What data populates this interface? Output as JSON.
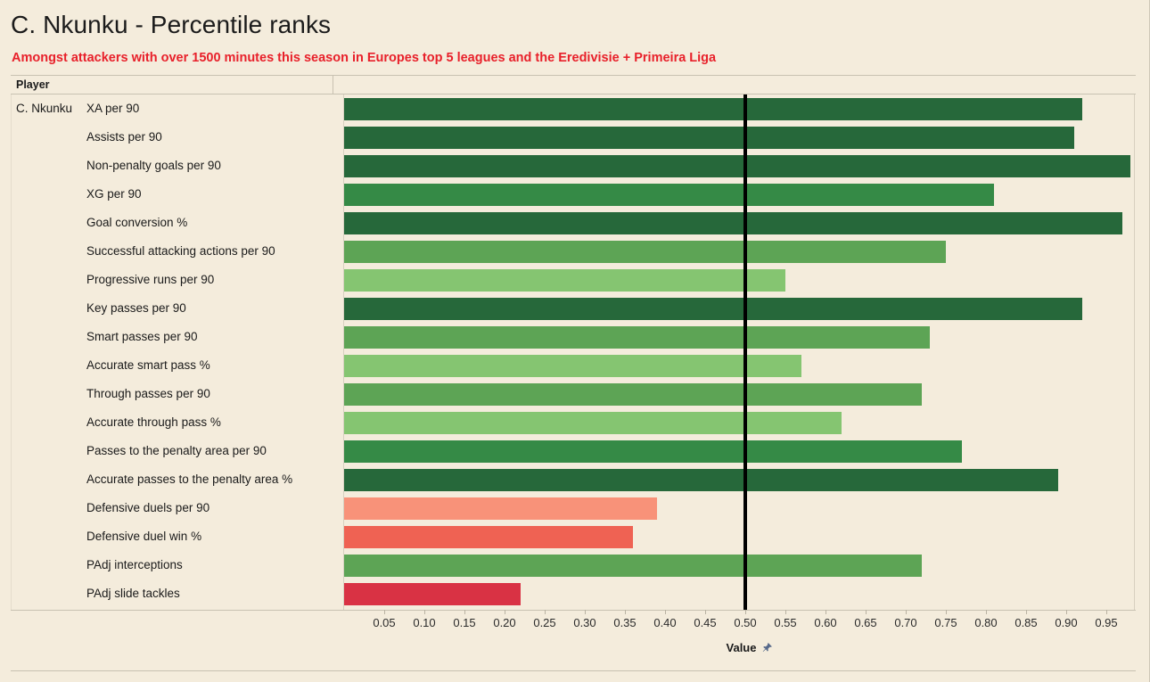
{
  "header": {
    "title": "C. Nkunku - Percentile ranks",
    "subtitle": "Amongst attackers with over 1500 minutes this season in Europes top 5 leagues and the Eredivisie + Primeira Liga",
    "subtitle_color": "#e8202a",
    "column_header": "Player"
  },
  "table": {
    "player_name": "C. Nkunku"
  },
  "axis": {
    "title": "Value",
    "sort_icon": "pin-icon",
    "ticks": [
      "0.05",
      "0.10",
      "0.15",
      "0.20",
      "0.25",
      "0.30",
      "0.35",
      "0.40",
      "0.45",
      "0.50",
      "0.55",
      "0.60",
      "0.65",
      "0.70",
      "0.75",
      "0.80",
      "0.85",
      "0.90",
      "0.95"
    ],
    "reference_value": 0.5
  },
  "palette": {
    "background": "#f4ecdc",
    "dark_green": "#26683a",
    "mid_dark_green": "#358a46",
    "mid_green": "#5da455",
    "light_green": "#85c571",
    "light_red": "#f89279",
    "mid_red": "#ef6253",
    "dark_red": "#d93244",
    "reference_line": "#000000"
  },
  "chart_data": {
    "type": "bar",
    "title": "C. Nkunku - Percentile ranks",
    "subtitle": "Amongst attackers with over 1500 minutes this season in Europes top 5 leagues and the Eredivisie + Primeira Liga",
    "xlabel": "Value",
    "ylabel": "",
    "orientation": "horizontal",
    "xlim": [
      0,
      1.0
    ],
    "xticks": [
      0.05,
      0.1,
      0.15,
      0.2,
      0.25,
      0.3,
      0.35,
      0.4,
      0.45,
      0.5,
      0.55,
      0.6,
      0.65,
      0.7,
      0.75,
      0.8,
      0.85,
      0.9,
      0.95
    ],
    "grid": false,
    "legend": "none",
    "reference_line": 0.5,
    "categories": [
      "XA per 90",
      "Assists per 90",
      "Non-penalty goals per 90",
      "XG per 90",
      "Goal conversion %",
      "Successful attacking actions per 90",
      "Progressive runs per 90",
      "Key passes per 90",
      "Smart passes per 90",
      "Accurate smart pass %",
      "Through passes per 90",
      "Accurate through pass %",
      "Passes to the penalty area per 90",
      "Accurate passes to the penalty area %",
      "Defensive duels per 90",
      "Defensive duel win %",
      "PAdj interceptions",
      "PAdj slide tackles"
    ],
    "values": [
      0.92,
      0.91,
      0.98,
      0.81,
      0.97,
      0.75,
      0.55,
      0.92,
      0.73,
      0.57,
      0.72,
      0.62,
      0.77,
      0.89,
      0.39,
      0.36,
      0.72,
      0.22
    ],
    "colors": [
      "#26683a",
      "#26683a",
      "#26683a",
      "#358a46",
      "#26683a",
      "#5da455",
      "#85c571",
      "#26683a",
      "#5da455",
      "#85c571",
      "#5da455",
      "#85c571",
      "#358a46",
      "#26683a",
      "#f89279",
      "#ef6253",
      "#5da455",
      "#d93244"
    ]
  }
}
